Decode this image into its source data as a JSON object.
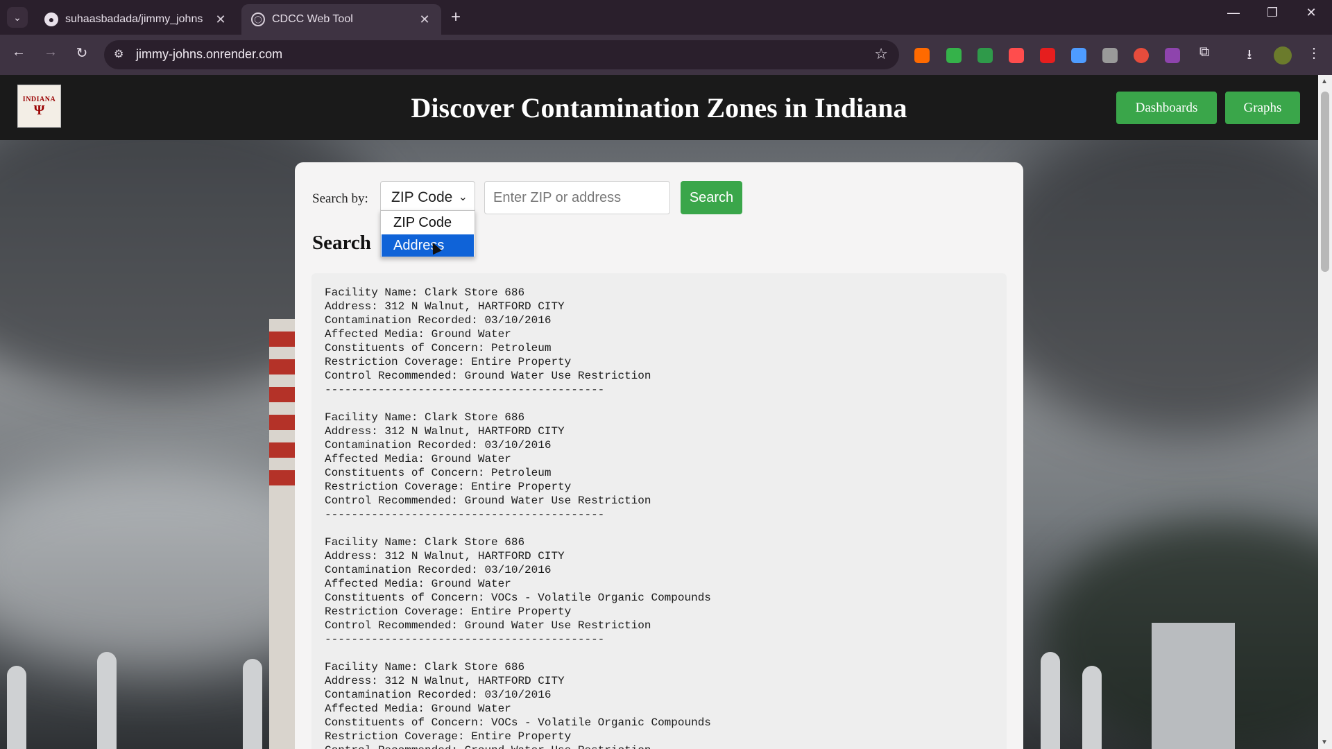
{
  "browser": {
    "tabs": [
      {
        "title": "suhaasbadada/jimmy_johns",
        "icon": "github-icon",
        "active": false
      },
      {
        "title": "CDCC Web Tool",
        "icon": "globe-icon",
        "active": true
      }
    ],
    "url": "jimmy-johns.onrender.com",
    "extension_colors": [
      "#ff6a00",
      "#35b24a",
      "#2f9a4a",
      "#ff4d4d",
      "#e61e1e",
      "#4e9cff",
      "#9a9a9a",
      "#e74c3c",
      "#8e44ad"
    ]
  },
  "header": {
    "logo_word": "INDIANA",
    "logo_mark": "Ψ",
    "title": "Discover Contamination Zones in Indiana",
    "nav": {
      "dashboards": "Dashboards",
      "graphs": "Graphs"
    }
  },
  "search": {
    "label": "Search by:",
    "selected": "ZIP Code",
    "options": [
      "ZIP Code",
      "Address"
    ],
    "highlighted_option": "Address",
    "input_value": "",
    "placeholder": "Enter ZIP or address",
    "button": "Search"
  },
  "results": {
    "heading": "Search",
    "divider": "------------------------------------------",
    "records": [
      {
        "facility": "Facility Name: Clark Store 686",
        "address": "Address: 312 N Walnut, HARTFORD CITY",
        "recorded": "Contamination Recorded: 03/10/2016",
        "media": "Affected Media: Ground Water",
        "constituents": "Constituents of Concern: Petroleum",
        "coverage": "Restriction Coverage: Entire Property",
        "control": "Control Recommended: Ground Water Use Restriction"
      },
      {
        "facility": "Facility Name: Clark Store 686",
        "address": "Address: 312 N Walnut, HARTFORD CITY",
        "recorded": "Contamination Recorded: 03/10/2016",
        "media": "Affected Media: Ground Water",
        "constituents": "Constituents of Concern: Petroleum",
        "coverage": "Restriction Coverage: Entire Property",
        "control": "Control Recommended: Ground Water Use Restriction"
      },
      {
        "facility": "Facility Name: Clark Store 686",
        "address": "Address: 312 N Walnut, HARTFORD CITY",
        "recorded": "Contamination Recorded: 03/10/2016",
        "media": "Affected Media: Ground Water",
        "constituents": "Constituents of Concern: VOCs - Volatile Organic Compounds",
        "coverage": "Restriction Coverage: Entire Property",
        "control": "Control Recommended: Ground Water Use Restriction"
      },
      {
        "facility": "Facility Name: Clark Store 686",
        "address": "Address: 312 N Walnut, HARTFORD CITY",
        "recorded": "Contamination Recorded: 03/10/2016",
        "media": "Affected Media: Ground Water",
        "constituents": "Constituents of Concern: VOCs - Volatile Organic Compounds",
        "coverage": "Restriction Coverage: Entire Property",
        "control": "Control Recommended: Ground Water Use Restriction"
      }
    ]
  },
  "colors": {
    "accent_green": "#3aa64a",
    "header_bg": "#1a1a1a",
    "selection_blue": "#0f63d8"
  }
}
